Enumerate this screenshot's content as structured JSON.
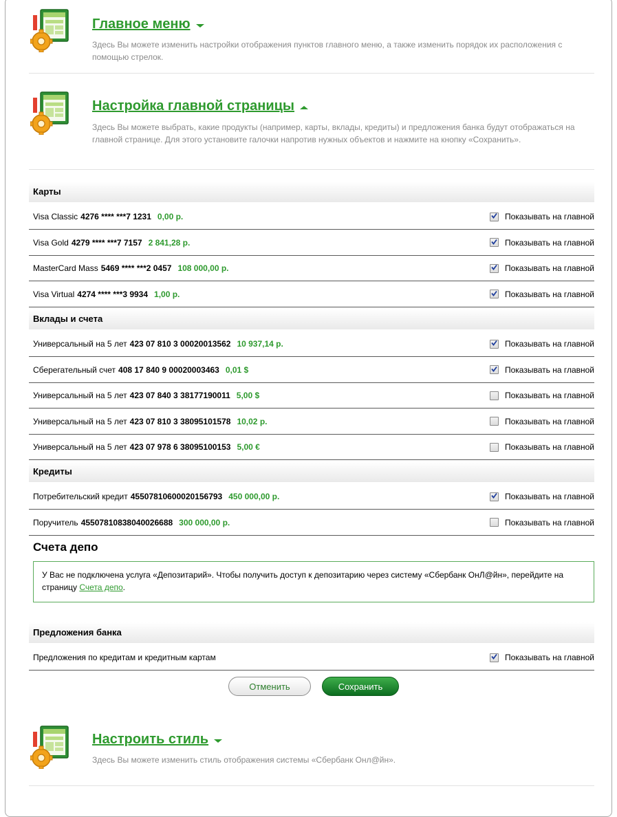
{
  "sections": {
    "main_menu": {
      "title": "Главное меню",
      "description": "Здесь Вы можете изменить настройки отображения пунктов главного меню, а также изменить порядок их расположения с помощью стрелок."
    },
    "main_page": {
      "title": "Настройка главной страницы",
      "description": "Здесь Вы можете выбрать, какие продукты (например, карты, вклады, кредиты) и предложения банка будут отображаться на главной странице. Для этого установите галочки напротив нужных объектов и нажмите на кнопку «Сохранить»."
    },
    "style": {
      "title": "Настроить стиль",
      "description": "Здесь Вы можете изменить стиль отображения системы «Сбербанк Онл@йн»."
    }
  },
  "show_label": "Показывать на главной",
  "cards": {
    "header": "Карты",
    "items": [
      {
        "name": "Visa Classic",
        "number": "4276 **** ***7 1231",
        "amount": "0,00 р.",
        "checked": true
      },
      {
        "name": "Visa Gold",
        "number": "4279 **** ***7 7157",
        "amount": "2 841,28 р.",
        "checked": true
      },
      {
        "name": "MasterCard Mass",
        "number": "5469 **** ***2 0457",
        "amount": "108 000,00 р.",
        "checked": true
      },
      {
        "name": "Visa Virtual",
        "number": "4274 **** ***3 9934",
        "amount": "1,00 р.",
        "checked": true
      }
    ]
  },
  "deposits": {
    "header": "Вклады и счета",
    "items": [
      {
        "name": "Универсальный на 5 лет",
        "number": "423 07 810 3 00020013562",
        "amount": "10 937,14 р.",
        "checked": true
      },
      {
        "name": "Сберегательный счет",
        "number": "408 17 840 9 00020003463",
        "amount": "0,01 $",
        "checked": true
      },
      {
        "name": "Универсальный на 5 лет",
        "number": "423 07 840 3 38177190011",
        "amount": "5,00 $",
        "checked": false
      },
      {
        "name": "Универсальный на 5 лет",
        "number": "423 07 810 3 38095101578",
        "amount": "10,02 р.",
        "checked": false
      },
      {
        "name": "Универсальный на 5 лет",
        "number": "423 07 978 6 38095100153",
        "amount": "5,00 €",
        "checked": false
      }
    ]
  },
  "credits": {
    "header": "Кредиты",
    "items": [
      {
        "name": "Потребительский кредит",
        "number": "45507810600020156793",
        "amount": "450 000,00 р.",
        "checked": true
      },
      {
        "name": "Поручитель",
        "number": "45507810838040026688",
        "amount": "300 000,00 р.",
        "checked": false
      }
    ]
  },
  "depo": {
    "title": "Счета депо",
    "message": "У Вас не подключена услуга «Депозитарий». Чтобы получить доступ к депозитарию через систему «Сбербанк ОнЛ@йн», перейдите на страницу ",
    "link": "Счета депо",
    "tail": "."
  },
  "offers": {
    "header": "Предложения банка",
    "items": [
      {
        "name": "Предложения по кредитам и кредитным картам",
        "checked": true
      }
    ]
  },
  "buttons": {
    "cancel": "Отменить",
    "save": "Сохранить"
  },
  "colors": {
    "accent_green": "#2e9a2e",
    "save_button": "#1a8a2c",
    "checkbox_check": "#1f3e9c"
  },
  "icons": {
    "section": "settings-gear-window-icon",
    "expand": "chevron-down-icon",
    "collapse": "chevron-up-icon",
    "check": "check-mark-icon"
  }
}
